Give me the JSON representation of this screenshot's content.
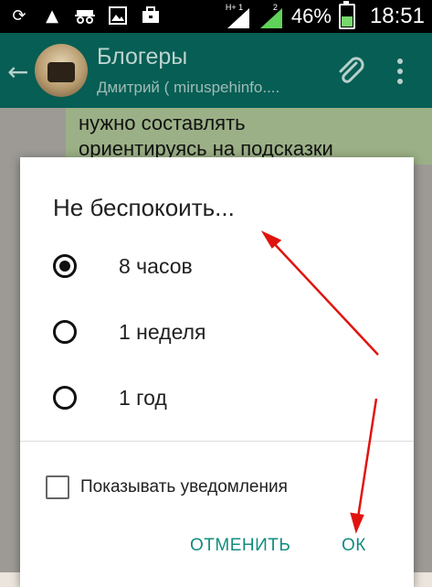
{
  "status_bar": {
    "icons": [
      "sync-icon",
      "warning-icon",
      "incognito-icon",
      "image-icon",
      "briefcase-icon"
    ],
    "sim1_label": "H+ 1",
    "sim2_label": "2",
    "battery_percent": "46%",
    "battery_level": 0.46,
    "time": "18:51"
  },
  "toolbar": {
    "back_icon": "arrow-back-icon",
    "title": "Блогеры",
    "subtitle": "Дмитрий ( mirusрehinfo....",
    "attach_icon": "paperclip-icon",
    "more_icon": "more-vert-icon",
    "color": "#075e54"
  },
  "chat": {
    "message_lines": [
      "нужно составлять",
      "ориентируясь на подсказки"
    ]
  },
  "dialog": {
    "title": "Не беспокоить...",
    "options": [
      {
        "label": "8 часов",
        "checked": true
      },
      {
        "label": "1 неделя",
        "checked": false
      },
      {
        "label": "1 год",
        "checked": false
      }
    ],
    "show_notifications_label": "Показывать уведомления",
    "show_notifications_checked": false,
    "cancel_label": "ОТМЕНИТЬ",
    "ok_label": "ОК",
    "accent": "#128c7e"
  },
  "annotations": {
    "arrow_color": "#e0140f"
  }
}
